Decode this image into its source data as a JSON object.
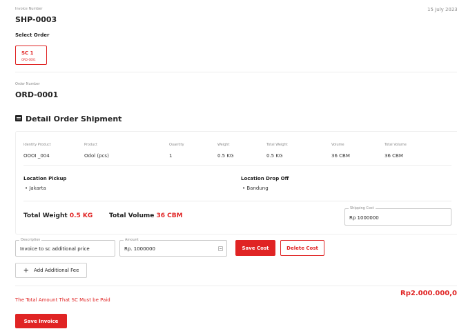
{
  "invoice": {
    "number_label": "Invoice Number",
    "number": "SHP-0003",
    "date": "15 July 2023"
  },
  "select_order": {
    "title": "Select Order",
    "card_title": "SC 1",
    "card_sub": "ORD-0001"
  },
  "order": {
    "number_label": "Order Number",
    "number": "ORD-0001"
  },
  "detail": {
    "title": "Detail Order Shipment",
    "columns": [
      "Identity Product",
      "Product",
      "Quantity",
      "Weight",
      "Total Weight",
      "Volume",
      "Total Volume"
    ],
    "row": [
      "OOOI _004",
      "Odol (pcs)",
      "1",
      "0.5 KG",
      "0.5 KG",
      "36 CBM",
      "36 CBM"
    ],
    "location_pickup_label": "Location Pickup",
    "location_pickup": "Jakarta",
    "location_dropoff_label": "Location Drop Off",
    "location_dropoff": "Bandung",
    "total_weight_label": "Total Weight",
    "total_weight_value": "0.5 KG",
    "total_volume_label": "Total Volume",
    "total_volume_value": "36 CBM",
    "shipping_cost_label": "Shipping Cost",
    "shipping_cost_value": "Rp 1000000"
  },
  "fee": {
    "description_label": "Description",
    "description_value": "Invoice to sc additional price",
    "amount_label": "Amount",
    "amount_value": "Rp. 1000000",
    "save_cost": "Save Cost",
    "delete_cost": "Delete Cost",
    "add_fee": "Add Additional Fee"
  },
  "summary": {
    "total_label": "The Total Amount That SC Must be Paid",
    "total_value": "Rp2.000.000,00",
    "save_invoice": "Save Invoice"
  },
  "colors": {
    "accent": "#e02424"
  }
}
